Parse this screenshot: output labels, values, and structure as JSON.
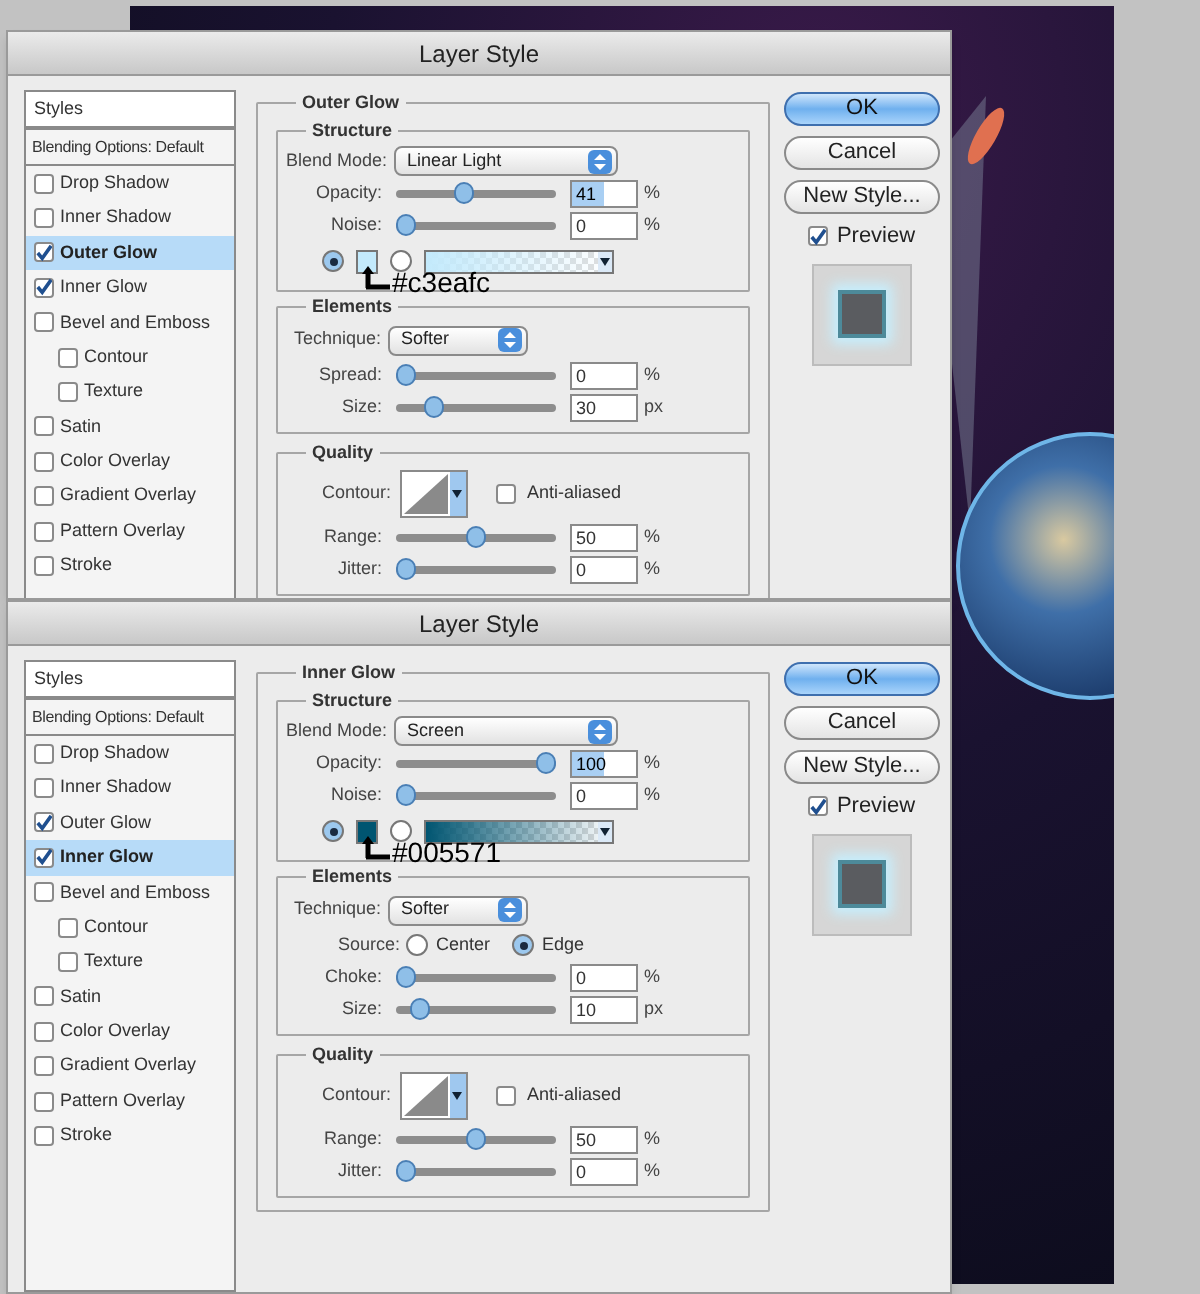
{
  "dialogs": [
    {
      "title": "Layer Style",
      "styles_label": "Styles",
      "blending_label": "Blending Options: Default",
      "effects": [
        {
          "label": "Drop Shadow",
          "checked": false,
          "selected": false
        },
        {
          "label": "Inner Shadow",
          "checked": false,
          "selected": false
        },
        {
          "label": "Outer Glow",
          "checked": true,
          "selected": true
        },
        {
          "label": "Inner Glow",
          "checked": true,
          "selected": false
        },
        {
          "label": "Bevel and Emboss",
          "checked": false,
          "selected": false,
          "children": [
            {
              "label": "Contour",
              "checked": false,
              "selected": false
            },
            {
              "label": "Texture",
              "checked": false,
              "selected": false
            }
          ]
        },
        {
          "label": "Satin",
          "checked": false,
          "selected": false
        },
        {
          "label": "Color Overlay",
          "checked": false,
          "selected": false
        },
        {
          "label": "Gradient Overlay",
          "checked": false,
          "selected": false
        },
        {
          "label": "Pattern Overlay",
          "checked": false,
          "selected": false
        },
        {
          "label": "Stroke",
          "checked": false,
          "selected": false
        }
      ],
      "panel": {
        "title": "Outer Glow",
        "structure": {
          "title": "Structure",
          "blend_mode": {
            "label": "Blend Mode:",
            "value": "Linear Light"
          },
          "sliders": [
            {
              "label": "Opacity:",
              "value": "41",
              "unit": "%",
              "level": 0.41,
              "text_selected": true
            },
            {
              "label": "Noise:",
              "value": "0",
              "unit": "%",
              "level": 0,
              "text_selected": false
            }
          ],
          "fill": {
            "options": [
              {
                "kind": "color",
                "selected": true
              },
              {
                "kind": "gradient",
                "selected": false
              }
            ],
            "color": "#c3eafc",
            "annotation": "#c3eafc"
          }
        },
        "elements": {
          "title": "Elements",
          "technique": {
            "label": "Technique:",
            "value": "Softer"
          },
          "sliders": [
            {
              "label": "Spread:",
              "value": "0",
              "unit": "%",
              "level": 0,
              "text_selected": false
            },
            {
              "label": "Size:",
              "value": "30",
              "unit": "px",
              "level": 0.2,
              "text_selected": false
            }
          ]
        },
        "quality": {
          "title": "Quality",
          "contour_label": "Contour:",
          "anti_aliased": {
            "label": "Anti-aliased",
            "checked": false
          },
          "sliders": [
            {
              "label": "Range:",
              "value": "50",
              "unit": "%",
              "level": 0.5,
              "text_selected": false
            },
            {
              "label": "Jitter:",
              "value": "0",
              "unit": "%",
              "level": 0,
              "text_selected": false
            }
          ]
        }
      },
      "buttons": [
        {
          "label": "OK",
          "default": true
        },
        {
          "label": "Cancel",
          "default": false
        },
        {
          "label": "New Style...",
          "default": false
        }
      ],
      "preview": {
        "label": "Preview",
        "checked": true
      }
    },
    {
      "title": "Layer Style",
      "styles_label": "Styles",
      "blending_label": "Blending Options: Default",
      "effects": [
        {
          "label": "Drop Shadow",
          "checked": false,
          "selected": false
        },
        {
          "label": "Inner Shadow",
          "checked": false,
          "selected": false
        },
        {
          "label": "Outer Glow",
          "checked": true,
          "selected": false
        },
        {
          "label": "Inner Glow",
          "checked": true,
          "selected": true
        },
        {
          "label": "Bevel and Emboss",
          "checked": false,
          "selected": false,
          "children": [
            {
              "label": "Contour",
              "checked": false,
              "selected": false
            },
            {
              "label": "Texture",
              "checked": false,
              "selected": false
            }
          ]
        },
        {
          "label": "Satin",
          "checked": false,
          "selected": false
        },
        {
          "label": "Color Overlay",
          "checked": false,
          "selected": false
        },
        {
          "label": "Gradient Overlay",
          "checked": false,
          "selected": false
        },
        {
          "label": "Pattern Overlay",
          "checked": false,
          "selected": false
        },
        {
          "label": "Stroke",
          "checked": false,
          "selected": false
        }
      ],
      "panel": {
        "title": "Inner Glow",
        "structure": {
          "title": "Structure",
          "blend_mode": {
            "label": "Blend Mode:",
            "value": "Screen"
          },
          "sliders": [
            {
              "label": "Opacity:",
              "value": "100",
              "unit": "%",
              "level": 1,
              "text_selected": true
            },
            {
              "label": "Noise:",
              "value": "0",
              "unit": "%",
              "level": 0,
              "text_selected": false
            }
          ],
          "fill": {
            "options": [
              {
                "kind": "color",
                "selected": true
              },
              {
                "kind": "gradient",
                "selected": false
              }
            ],
            "color": "#005571",
            "annotation": "#005571"
          }
        },
        "elements": {
          "title": "Elements",
          "technique": {
            "label": "Technique:",
            "value": "Softer"
          },
          "source": {
            "label": "Source:",
            "options": [
              {
                "label": "Center",
                "selected": false
              },
              {
                "label": "Edge",
                "selected": true
              }
            ]
          },
          "sliders": [
            {
              "label": "Choke:",
              "value": "0",
              "unit": "%",
              "level": 0,
              "text_selected": false
            },
            {
              "label": "Size:",
              "value": "10",
              "unit": "px",
              "level": 0.1,
              "text_selected": false
            }
          ]
        },
        "quality": {
          "title": "Quality",
          "contour_label": "Contour:",
          "anti_aliased": {
            "label": "Anti-aliased",
            "checked": false
          },
          "sliders": [
            {
              "label": "Range:",
              "value": "50",
              "unit": "%",
              "level": 0.5,
              "text_selected": false
            },
            {
              "label": "Jitter:",
              "value": "0",
              "unit": "%",
              "level": 0,
              "text_selected": false
            }
          ]
        }
      },
      "buttons": [
        {
          "label": "OK",
          "default": true
        },
        {
          "label": "Cancel",
          "default": false
        },
        {
          "label": "New Style...",
          "default": false
        }
      ],
      "preview": {
        "label": "Preview",
        "checked": true
      }
    }
  ]
}
